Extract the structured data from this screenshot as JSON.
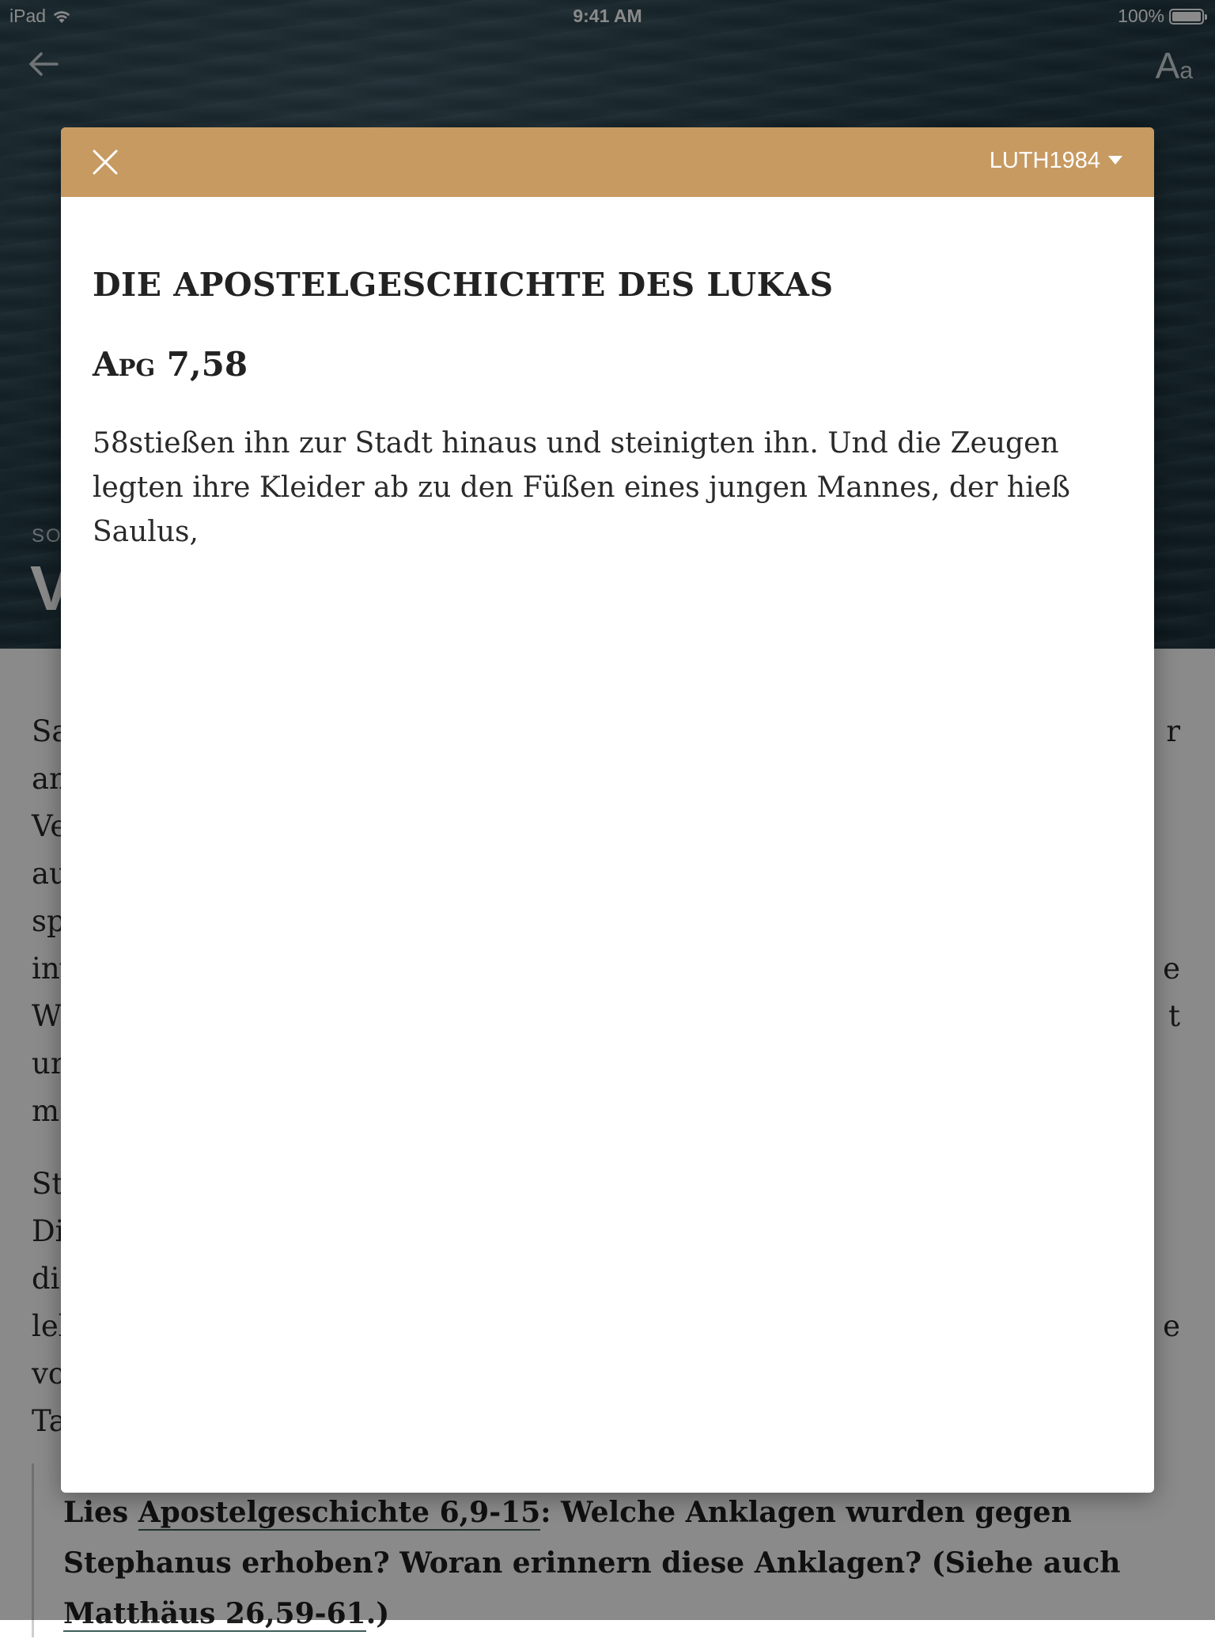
{
  "status_bar": {
    "device": "iPad",
    "time": "9:41 AM",
    "battery": "100%",
    "battery_level": 1.0
  },
  "header": {
    "kicker": "SO",
    "title_fragment": "V"
  },
  "background_text": {
    "paragraph1": [
      {
        "left": "Sa",
        "right": "r"
      },
      {
        "left": "an",
        "right": ""
      },
      {
        "left": "Ve",
        "right": ""
      },
      {
        "left": "au",
        "right": ""
      },
      {
        "left": "sp",
        "right": ""
      },
      {
        "left": "inv",
        "right": "e"
      },
      {
        "left": "W",
        "right": "t"
      },
      {
        "left": "ur",
        "right": ""
      },
      {
        "left": "ma",
        "right": ""
      }
    ],
    "paragraph2": [
      {
        "left": "St",
        "right": ""
      },
      {
        "left": "Di",
        "right": ""
      },
      {
        "left": "dis",
        "right": ""
      },
      {
        "left": "leb",
        "right": "e"
      },
      {
        "left": "vo",
        "right": ""
      },
      {
        "left": "Ta",
        "right": ""
      }
    ]
  },
  "question": {
    "prefix": "Lies ",
    "link1": "Apostelgeschichte 6,9-15",
    "middle": ": Welche Anklagen wurden gegen Stephanus erhoben? Woran erinnern diese Anklagen? (Siehe auch ",
    "link2": "Matthäus 26,59-61",
    "suffix": ".)"
  },
  "modal": {
    "header_color": "#c79a62",
    "version": "LUTH1984",
    "book_title": "DIE APOSTELGESCHICHTE DES LUKAS",
    "reference_book": "Apg",
    "reference_verse": "7,58",
    "verse_text": "58stießen ihn zur Stadt hinaus und steinigten ihn. Und die Zeugen legten ihre Kleider ab zu den Füßen eines jungen Mannes, der hieß Saulus,"
  }
}
